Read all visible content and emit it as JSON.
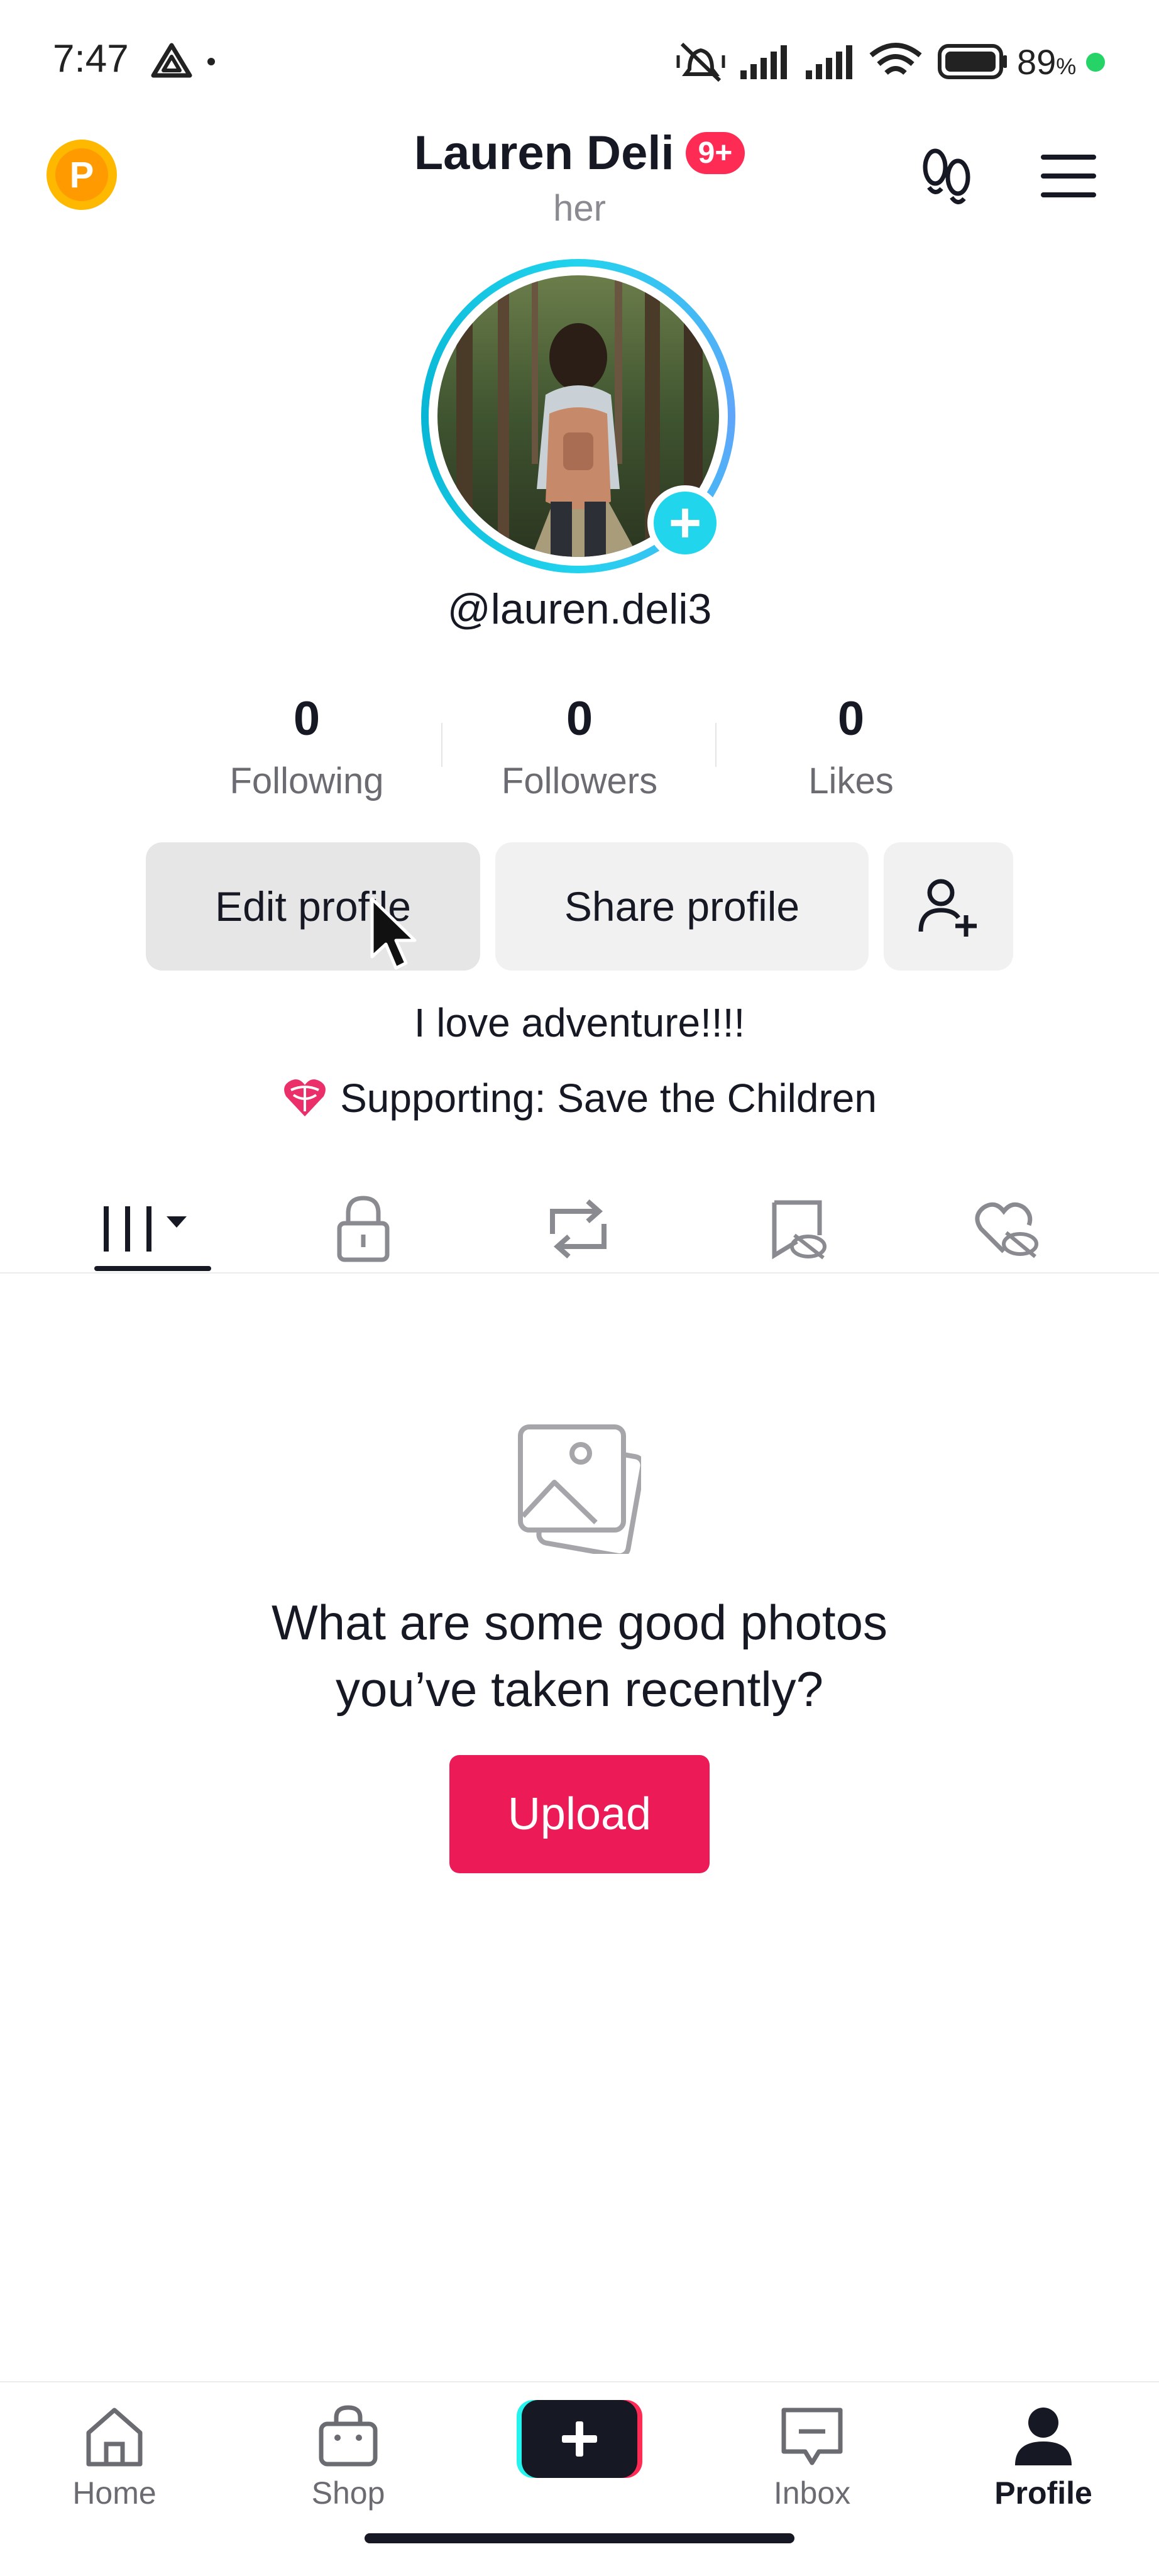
{
  "status_bar": {
    "time": "7:47",
    "battery_percent": "89",
    "battery_symbol": "%"
  },
  "header": {
    "name": "Lauren Deli",
    "notification_badge": "9+",
    "pronouns": "her",
    "coin_letter": "P"
  },
  "profile": {
    "username": "@lauren.deli3",
    "stats": [
      {
        "value": "0",
        "label": "Following"
      },
      {
        "value": "0",
        "label": "Followers"
      },
      {
        "value": "0",
        "label": "Likes"
      }
    ],
    "buttons": {
      "edit": "Edit profile",
      "share": "Share profile"
    },
    "bio": "I love adventure!!!!",
    "supporting": "Supporting: Save the Children"
  },
  "tabs": [
    "videos-grid-icon",
    "private-lock-icon",
    "repost-icon",
    "favorites-icon",
    "liked-icon"
  ],
  "empty_state": {
    "title_line1": "What are some good photos",
    "title_line2": "you’ve taken recently?",
    "upload_label": "Upload"
  },
  "bottom_nav": {
    "home": "Home",
    "shop": "Shop",
    "inbox": "Inbox",
    "profile": "Profile"
  },
  "colors": {
    "accent": "#fe2c55",
    "upload": "#ec1a56",
    "avatar_ring": "#22d3ee",
    "text": "#161823",
    "muted": "#8a8b91"
  }
}
